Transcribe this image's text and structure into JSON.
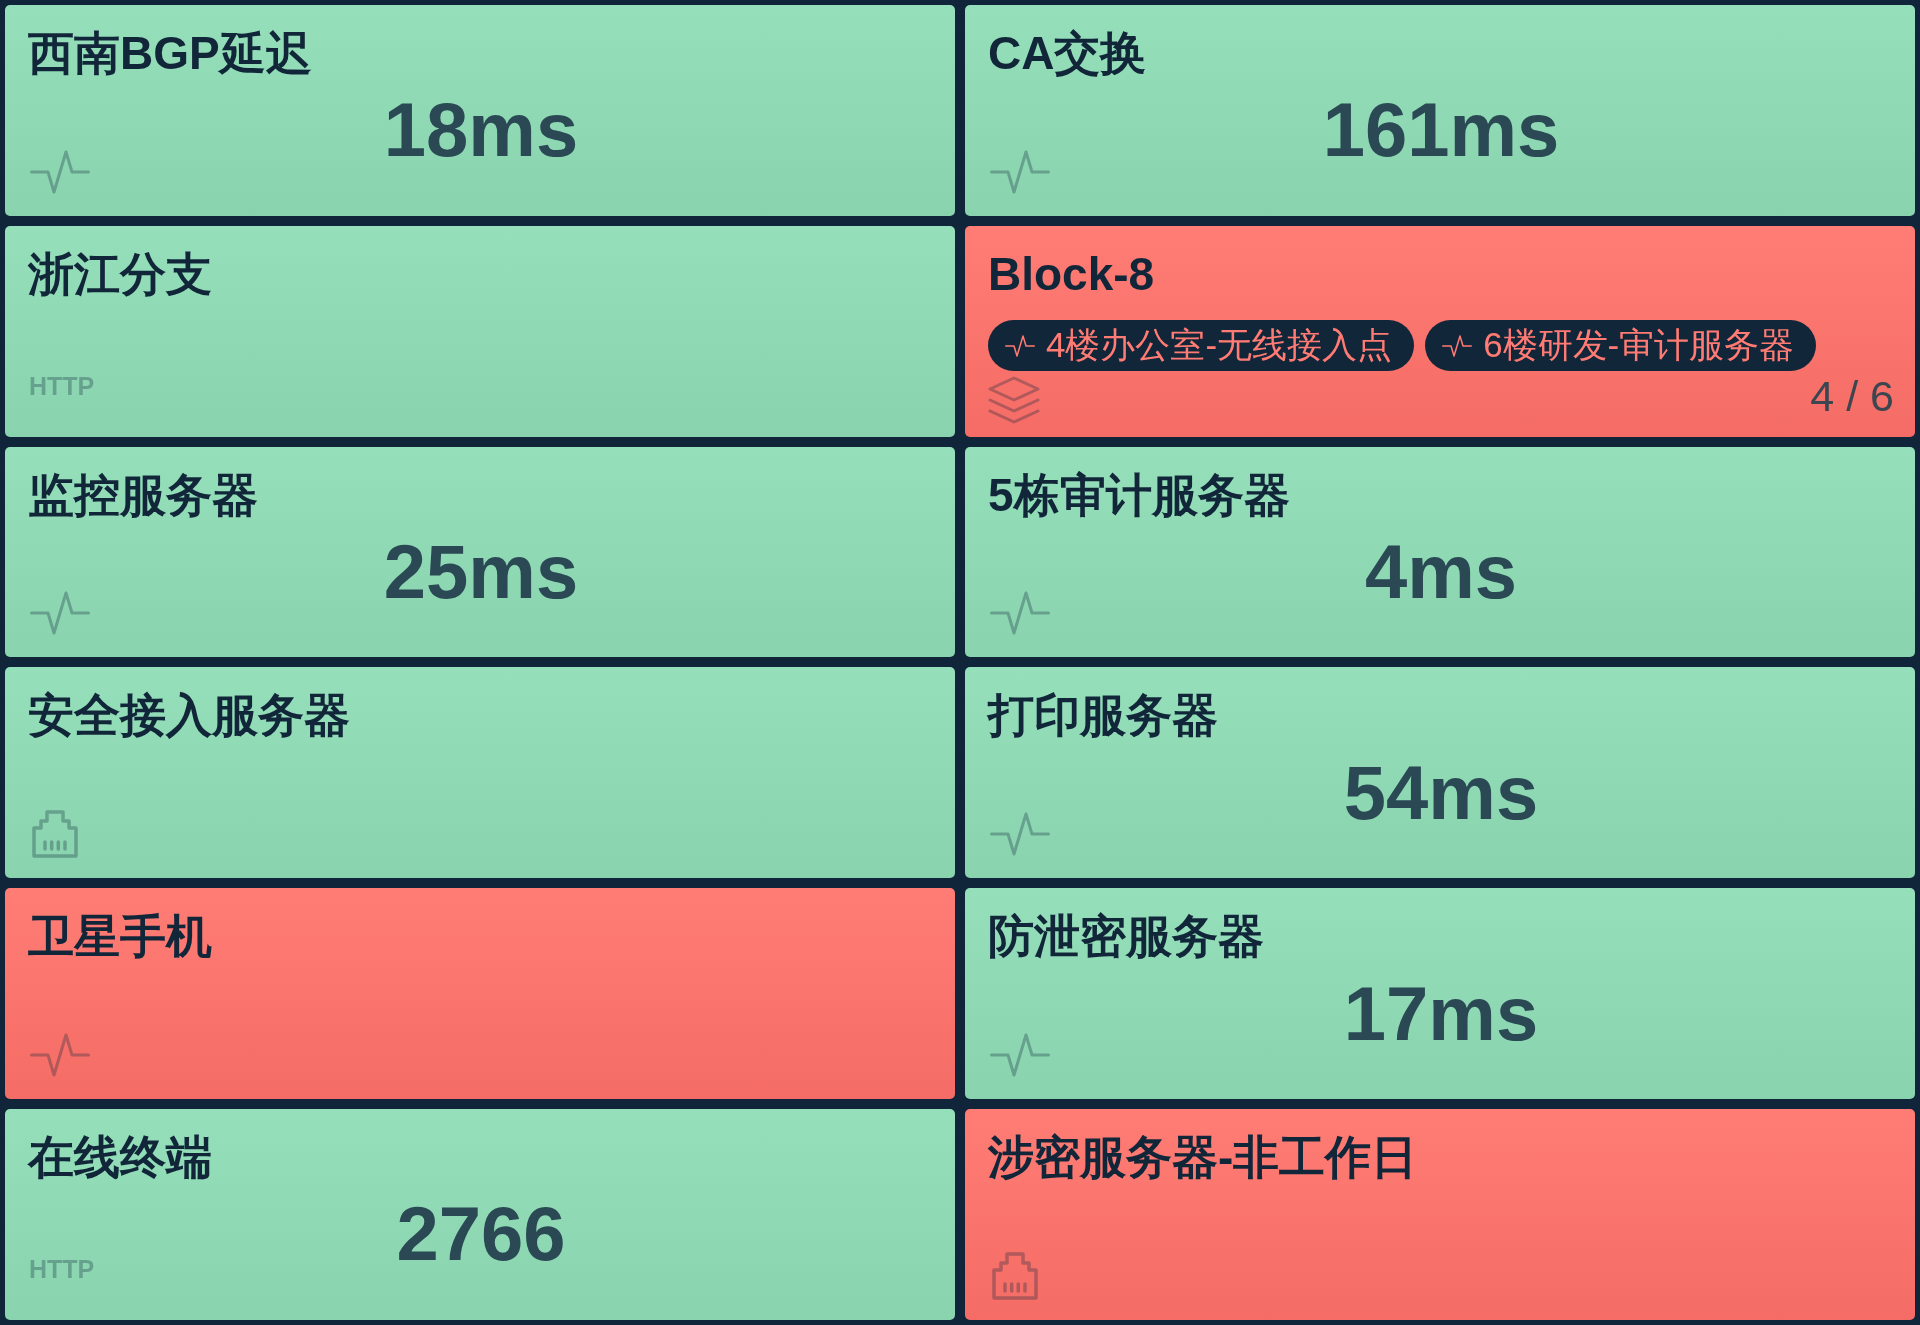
{
  "tiles": [
    {
      "title": "西南BGP延迟",
      "down": false,
      "kind": "ping",
      "value": "18ms"
    },
    {
      "title": "CA交换",
      "down": false,
      "kind": "ping",
      "value": "161ms"
    },
    {
      "title": "浙江分支",
      "down": false,
      "kind": "http",
      "protocol": "HTTP"
    },
    {
      "title": "Block-8",
      "down": true,
      "kind": "group",
      "members": [
        {
          "name": "4楼办公室-无线接入点",
          "down": true
        },
        {
          "name": "6楼研发-审计服务器",
          "down": true
        }
      ],
      "count": "4 / 6"
    },
    {
      "title": "监控服务器",
      "down": false,
      "kind": "ping",
      "value": "25ms"
    },
    {
      "title": "5栋审计服务器",
      "down": false,
      "kind": "ping",
      "value": "4ms"
    },
    {
      "title": "安全接入服务器",
      "down": false,
      "kind": "port"
    },
    {
      "title": "打印服务器",
      "down": false,
      "kind": "ping",
      "value": "54ms"
    },
    {
      "title": "卫星手机",
      "down": true,
      "kind": "ping"
    },
    {
      "title": "防泄密服务器",
      "down": false,
      "kind": "ping",
      "value": "17ms"
    },
    {
      "title": "在线终端",
      "down": false,
      "kind": "http",
      "protocol": "HTTP",
      "value": "2766"
    },
    {
      "title": "涉密服务器-非工作日",
      "down": true,
      "kind": "port"
    }
  ]
}
